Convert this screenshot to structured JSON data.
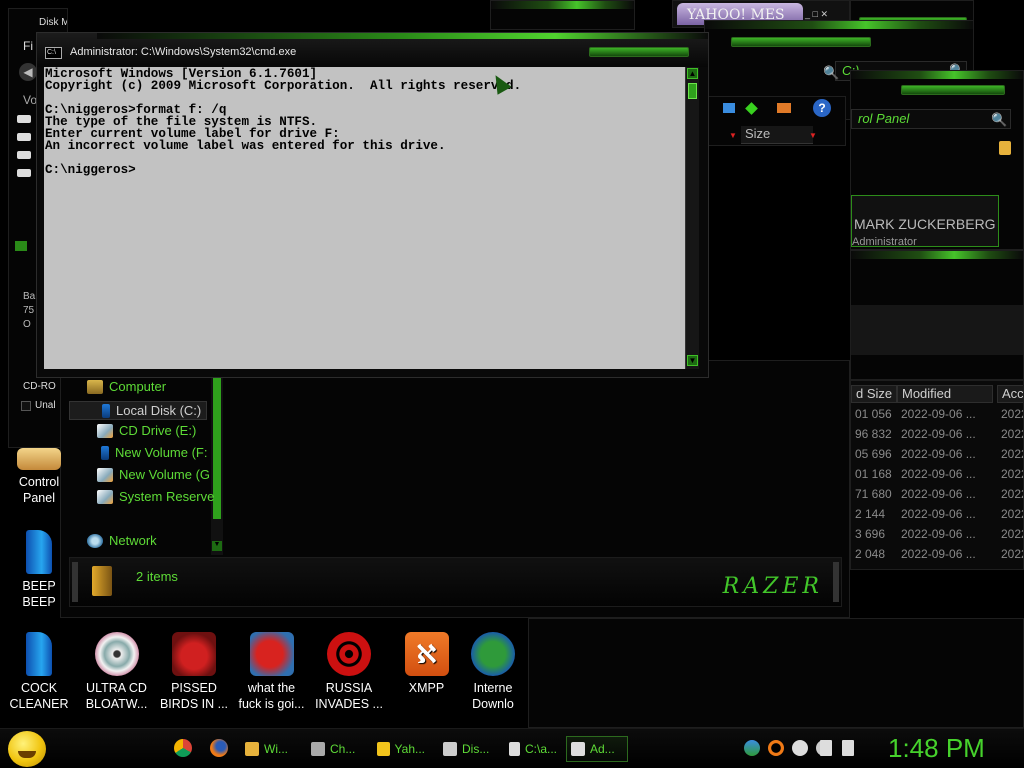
{
  "windows": {
    "disk_management": {
      "title": "Disk Management",
      "menu_first": "Fi",
      "volume_col": "Vo",
      "cdrom": "CD-RO",
      "unalloc": "Unal",
      "info1": "Ba",
      "info2": "75",
      "info3": "O"
    },
    "yahoo": {
      "title": "YAHOO! MES"
    },
    "computer_search": {
      "text": "C:)"
    },
    "control_panel": {
      "search": "rol Panel",
      "user_name": "MARK ZUCKERBERG",
      "user_role": "Administrator"
    },
    "explorer_header": {
      "size_col": "Size"
    }
  },
  "cmd": {
    "title": "Administrator: C:\\Windows\\System32\\cmd.exe",
    "icon_label": "C:\\",
    "lines": [
      "Microsoft Windows [Version 6.1.7601]",
      "Copyright (c) 2009 Microsoft Corporation.  All rights reserved.",
      "",
      "C:\\niggeros>format f: /q",
      "The type of the file system is NTFS.",
      "Enter current volume label for drive F:",
      "An incorrect volume label was entered for this drive.",
      "",
      "C:\\niggeros>"
    ]
  },
  "explorer": {
    "nav": [
      {
        "label": "Computer",
        "icon": "computer-icon"
      },
      {
        "label": "Local Disk (C:)",
        "icon": "drive-icon",
        "selected": true
      },
      {
        "label": "CD Drive (E:)",
        "icon": "cd-drive-icon"
      },
      {
        "label": "New Volume (F:",
        "icon": "drive-icon"
      },
      {
        "label": "New Volume (G",
        "icon": "cd-drive-icon"
      },
      {
        "label": "System Reserve",
        "icon": "cd-drive-icon"
      },
      {
        "label": "Network",
        "icon": "network-icon"
      }
    ],
    "status_count": "2 items",
    "brand": "RAZER"
  },
  "filelist": {
    "columns": [
      "d Size",
      "Modified",
      "Acc"
    ],
    "rows": [
      [
        "01 056",
        "2022-09-06 ...",
        "2022"
      ],
      [
        "96 832",
        "2022-09-06 ...",
        "2022"
      ],
      [
        "05 696",
        "2022-09-06 ...",
        "2022"
      ],
      [
        "01 168",
        "2022-09-06 ...",
        "2022"
      ],
      [
        "71 680",
        "2022-09-06 ...",
        "2022"
      ],
      [
        "2 144",
        "2022-09-06 ...",
        "2022"
      ],
      [
        "3 696",
        "2022-09-06 ...",
        "2022"
      ],
      [
        "2 048",
        "2022-09-06 ...",
        "2022"
      ]
    ]
  },
  "desktop": {
    "left_icons": [
      {
        "label1": "Control",
        "label2": "Panel"
      },
      {
        "label1": "BEEP",
        "label2": "BEEP"
      }
    ],
    "bottom_icons": [
      {
        "label1": "COCK",
        "label2": "CLEANER"
      },
      {
        "label1": "ULTRA CD",
        "label2": "BLOATW..."
      },
      {
        "label1": "PISSED",
        "label2": "BIRDS IN ..."
      },
      {
        "label1": "what the",
        "label2": "fuck is goi..."
      },
      {
        "label1": "RUSSIA",
        "label2": "INVADES ..."
      },
      {
        "label1": "XMPP",
        "label2": ""
      },
      {
        "label1": "Interne",
        "label2": "Downlo"
      }
    ]
  },
  "taskbar": {
    "buttons": [
      "Wi...",
      "Ch...",
      "Yah...",
      "Dis...",
      "C:\\a...",
      "Ad..."
    ],
    "clock": "1:48 PM"
  },
  "colors": {
    "accent": "#46d22c",
    "console_bg": "#c2c2c2"
  }
}
